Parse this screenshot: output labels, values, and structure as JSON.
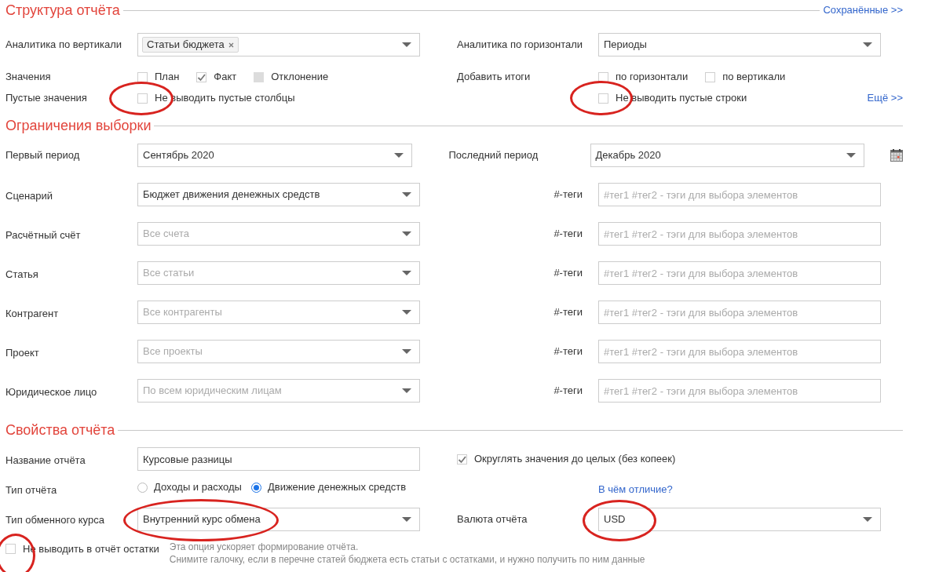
{
  "structure": {
    "title": "Структура отчёта",
    "link": "Сохранённые >>",
    "vertical": {
      "label": "Аналитика по вертикали",
      "tags": [
        "Статьи бюджета"
      ]
    },
    "horizontal": {
      "label": "Аналитика по горизонтали",
      "value": "Периоды"
    },
    "values": {
      "label": "Значения",
      "options": [
        {
          "label": "План",
          "checked": false,
          "disabled": false
        },
        {
          "label": "Факт",
          "checked": true,
          "disabled": false
        },
        {
          "label": "Отклонение",
          "checked": false,
          "disabled": true
        }
      ]
    },
    "totals": {
      "label": "Добавить итоги",
      "options": [
        {
          "label": "по горизонтали",
          "checked": false,
          "disabled": false
        },
        {
          "label": "по вертикали",
          "checked": false,
          "disabled": false
        }
      ]
    },
    "empty": {
      "label": "Пустые значения",
      "columns": {
        "label": "Не выводить пустые столбцы",
        "checked": false,
        "circled": true
      },
      "rows": {
        "label": "Не выводить пустые строки",
        "checked": false,
        "circled": true
      }
    },
    "more_link": "Ещё >>"
  },
  "filters": {
    "title": "Ограничения выборки",
    "period": {
      "first_label": "Первый период",
      "first_value": "Сентябрь 2020",
      "last_label": "Последний период",
      "last_value": "Декабрь 2020"
    },
    "rows": [
      {
        "label": "Сценарий",
        "value": "Бюджет движения денежных средств",
        "tags_label": "#-теги",
        "tags_placeholder": "#тег1 #тег2 - тэги для выбора элементов"
      },
      {
        "label": "Расчётный счёт",
        "placeholder": "Все счета",
        "tags_label": "#-теги",
        "tags_placeholder": "#тег1 #тег2 - тэги для выбора элементов"
      },
      {
        "label": "Статья",
        "placeholder": "Все статьи",
        "tags_label": "#-теги",
        "tags_placeholder": "#тег1 #тег2 - тэги для выбора элементов"
      },
      {
        "label": "Контрагент",
        "placeholder": "Все контрагенты",
        "tags_label": "#-теги",
        "tags_placeholder": "#тег1 #тег2 - тэги для выбора элементов"
      },
      {
        "label": "Проект",
        "placeholder": "Все проекты",
        "tags_label": "#-теги",
        "tags_placeholder": "#тег1 #тег2 - тэги для выбора элементов"
      },
      {
        "label": "Юридическое лицо",
        "placeholder": "По всем юридическим лицам",
        "tags_label": "#-теги",
        "tags_placeholder": "#тег1 #тег2 - тэги для выбора элементов"
      }
    ]
  },
  "properties": {
    "title": "Свойства отчёта",
    "name": {
      "label": "Название отчёта",
      "value": "Курсовые разницы"
    },
    "rounding": {
      "label": "Округлять значения до целых (без копеек)",
      "checked": true
    },
    "type": {
      "label": "Тип отчёта",
      "options": [
        {
          "label": "Доходы и расходы",
          "selected": false
        },
        {
          "label": "Движение денежных средств",
          "selected": true
        }
      ],
      "link": "В чём отличие?"
    },
    "rate": {
      "label": "Тип обменного курса",
      "value": "Внутренний курс обмена",
      "circled": true
    },
    "currency": {
      "label": "Валюта отчёта",
      "value": "USD",
      "circled": true
    },
    "balances": {
      "label": "Не выводить в отчёт остатки",
      "checked": false,
      "circled": true,
      "hint": [
        "Эта опция ускоряет формирование отчёта.",
        "Снимите галочку, если в перечне статей бюджета есть статьи с остатками, и нужно получить по ним данные"
      ]
    }
  }
}
